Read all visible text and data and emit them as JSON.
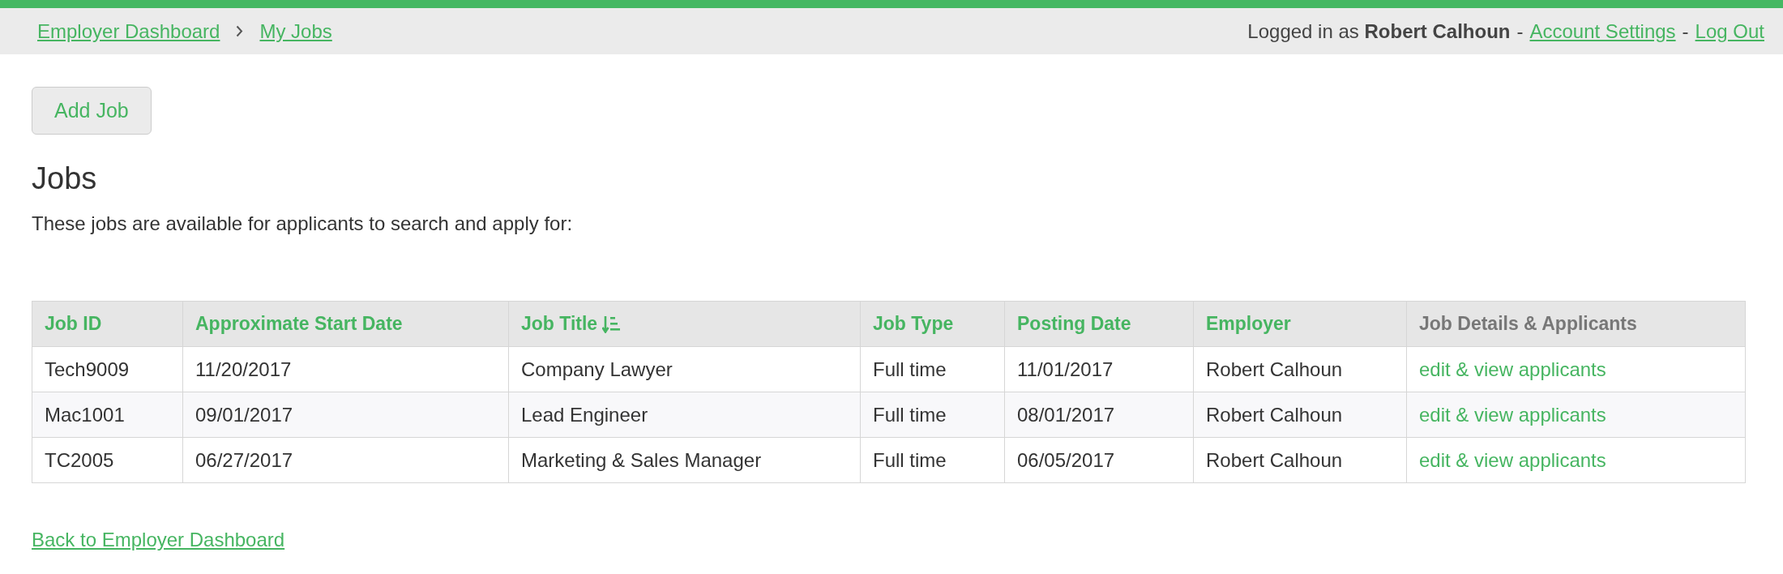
{
  "top_bar": {
    "breadcrumbs": [
      {
        "label": "Employer Dashboard"
      },
      {
        "label": "My Jobs"
      }
    ],
    "user_menu": [
      {
        "kind": "text",
        "text": "Logged in as **Robert Calhoun**"
      },
      {
        "kind": "separator",
        "text": "-"
      },
      {
        "kind": "link",
        "text": "Account Settings"
      },
      {
        "kind": "separator",
        "text": "-"
      },
      {
        "kind": "link",
        "text": "Log Out"
      }
    ]
  },
  "add_job_button": "Add Job",
  "heading": "Jobs",
  "intro": "These jobs are available for applicants to search and apply for:",
  "table": {
    "columns": [
      {
        "label": "Job ID",
        "sortable": true,
        "sorted": false
      },
      {
        "label": "Approximate Start Date",
        "sortable": true,
        "sorted": false
      },
      {
        "label": "Job Title",
        "sortable": true,
        "sorted": true
      },
      {
        "label": "Job Type",
        "sortable": true,
        "sorted": false
      },
      {
        "label": "Posting Date",
        "sortable": true,
        "sorted": false
      },
      {
        "label": "Employer",
        "sortable": true,
        "sorted": false
      },
      {
        "label": "Job Details & Applicants",
        "sortable": false,
        "sorted": false
      }
    ],
    "rows": [
      {
        "cells": [
          "Tech9009",
          "11/20/2017",
          "Company Lawyer",
          "Full time",
          "11/01/2017",
          "Robert Calhoun"
        ],
        "action": "edit & view applicants"
      },
      {
        "cells": [
          "Mac1001",
          "09/01/2017",
          "Lead Engineer",
          "Full time",
          "08/01/2017",
          "Robert Calhoun"
        ],
        "action": "edit & view applicants"
      },
      {
        "cells": [
          "TC2005",
          "06/27/2017",
          "Marketing & Sales Manager",
          "Full time",
          "06/05/2017",
          "Robert Calhoun"
        ],
        "action": "edit & view applicants"
      }
    ]
  },
  "back_link": "Back to Employer Dashboard"
}
